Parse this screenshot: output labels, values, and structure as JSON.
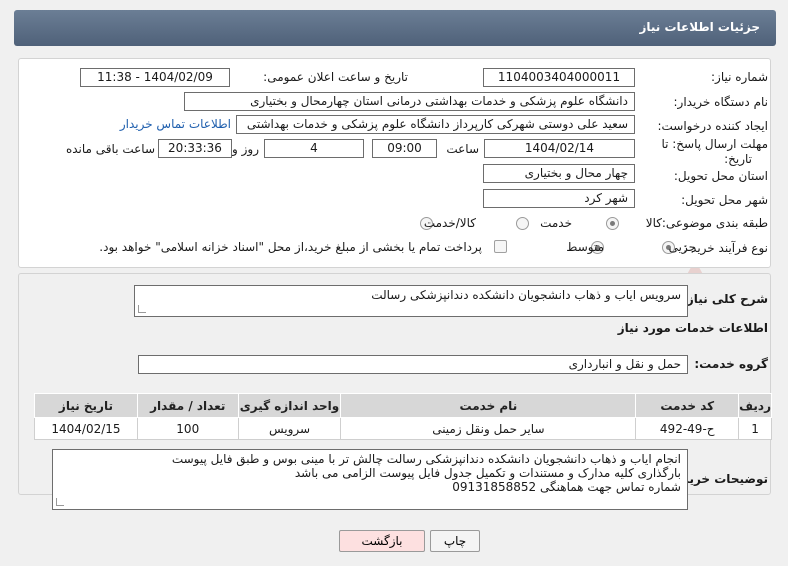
{
  "header": {
    "title": "جزئیات اطلاعات نیاز"
  },
  "form": {
    "need_number_label": "شماره نیاز:",
    "need_number": "1104003404000011",
    "announce_label": "تاریخ و ساعت اعلان عمومی:",
    "announce_value": "1404/02/09 - 11:38",
    "buyer_label": "نام دستگاه خریدار:",
    "buyer_value": "دانشگاه علوم پزشکی و خدمات بهداشتی درمانی استان چهارمحال و بختیاری",
    "creator_label": "ایجاد کننده درخواست:",
    "creator_value": "سعید علی دوستی شهرکی کارپرداز دانشگاه علوم پزشکی و خدمات بهداشتی",
    "contact_link": "اطلاعات تماس خریدار",
    "deadline_label_1": "مهلت ارسال پاسخ: تا",
    "deadline_label_2": "تاریخ:",
    "deadline_date": "1404/02/14",
    "time_label": "ساعت",
    "deadline_time": "09:00",
    "days_value": "4",
    "days_label": "روز و",
    "remaining_time": "20:33:36",
    "remaining_label": "ساعت باقی مانده",
    "province_label": "استان محل تحویل:",
    "province_value": "چهار محال و بختیاری",
    "city_label": "شهر محل تحویل:",
    "city_value": "شهر کرد",
    "category_label": "طبقه بندی موضوعی:",
    "category_options": [
      "کالا",
      "خدمت",
      "کالا/خدمت"
    ],
    "process_label": "نوع فرآیند خرید :",
    "process_options": [
      "جزیی",
      "متوسط"
    ],
    "payment_note": "پرداخت تمام یا بخشی از مبلغ خرید،از محل \"اسناد خزانه اسلامی\" خواهد بود."
  },
  "summary": {
    "label": "شرح کلی نیاز:",
    "value": "سرویس ایاب و ذهاب دانشجویان دانشکده دندانپزشکی رسالت"
  },
  "services": {
    "section_title": "اطلاعات خدمات مورد نیاز",
    "group_label": "گروه خدمت:",
    "group_value": "حمل و نقل و انبارداری",
    "columns": [
      "ردیف",
      "کد خدمت",
      "نام خدمت",
      "واحد اندازه گیری",
      "تعداد / مقدار",
      "تاریخ نیاز"
    ],
    "rows": [
      [
        "1",
        "ح-49-492",
        "سایر حمل ونقل زمینی",
        "سرویس",
        "100",
        "1404/02/15"
      ]
    ]
  },
  "notes": {
    "label": "توضیحات خریدار:",
    "lines": [
      "انجام ایاب و ذهاب دانشجویان دانشکده دندانپزشکی رسالت چالش تر با مینی بوس و طبق فایل پیوست",
      "بارگذاری کلیه مدارک و مستندات و تکمیل جدول فایل پیوست الزامی می باشد",
      "شماره تماس جهت هماهنگی 09131858852"
    ]
  },
  "buttons": {
    "print": "چاپ",
    "back": "بازگشت"
  },
  "colors": {
    "header": "#5a6c83",
    "back_button": "#fde0e0",
    "link": "#1f5fae"
  }
}
